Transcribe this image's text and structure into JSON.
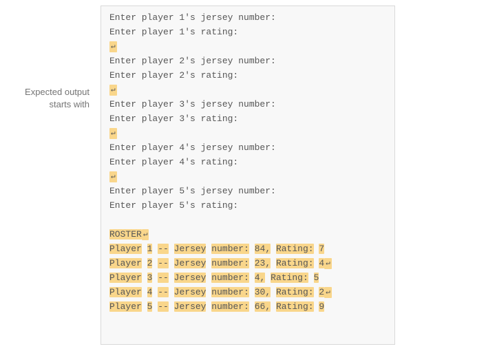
{
  "label": {
    "line1": "Expected output",
    "line2": "starts with"
  },
  "prompts": {
    "p1j": "Enter player 1's jersey number:",
    "p1r": "Enter player 1's rating:",
    "p2j": "Enter player 2's jersey number:",
    "p2r": "Enter player 2's rating:",
    "p3j": "Enter player 3's jersey number:",
    "p3r": "Enter player 3's rating:",
    "p4j": "Enter player 4's jersey number:",
    "p4r": "Enter player 4's rating:",
    "p5j": "Enter player 5's jersey number:",
    "p5r": "Enter player 5's rating:"
  },
  "newline_symbol": "↵",
  "roster": {
    "title": "ROSTER",
    "rows": [
      {
        "pre": "Player",
        "n": "1",
        "sep": "--",
        "jl": "Jersey",
        "nl": "number:",
        "jn": "84,",
        "rl": "Rating:",
        "rv": "7"
      },
      {
        "pre": "Player",
        "n": "2",
        "sep": "--",
        "jl": "Jersey",
        "nl": "number:",
        "jn": "23,",
        "rl": "Rating:",
        "rv": "4"
      },
      {
        "pre": "Player",
        "n": "3",
        "sep": "--",
        "jl": "Jersey",
        "nl": "number:",
        "jn": "4,",
        "rl": "Rating:",
        "rv": "5"
      },
      {
        "pre": "Player",
        "n": "4",
        "sep": "--",
        "jl": "Jersey",
        "nl": "number:",
        "jn": "30,",
        "rl": "Rating:",
        "rv": "2"
      },
      {
        "pre": "Player",
        "n": "5",
        "sep": "--",
        "jl": "Jersey",
        "nl": "number:",
        "jn": "66,",
        "rl": "Rating:",
        "rv": "9"
      }
    ]
  }
}
